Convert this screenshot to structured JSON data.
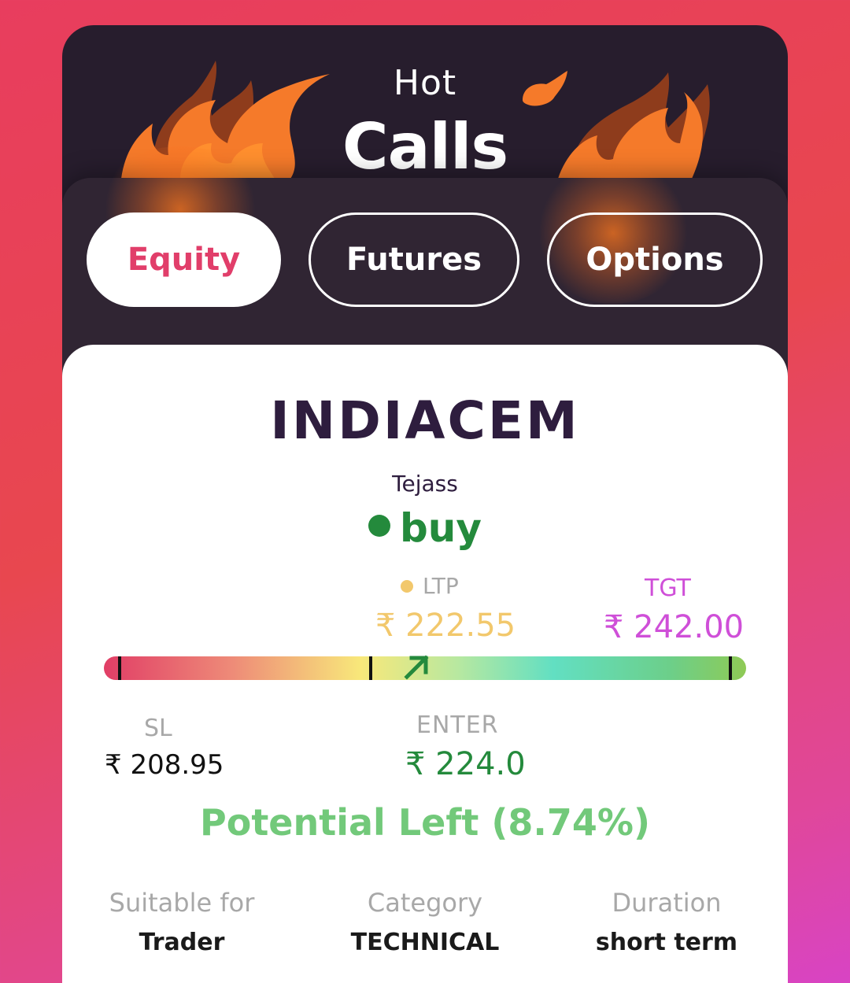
{
  "header": {
    "title_line1": "Hot",
    "title_line2": "Calls"
  },
  "tabs": [
    {
      "label": "Equity",
      "active": true
    },
    {
      "label": "Futures",
      "active": false
    },
    {
      "label": "Options",
      "active": false
    }
  ],
  "call": {
    "symbol": "INDIACEM",
    "analyst": "Tejass",
    "action": "buy",
    "ltp_label": "LTP",
    "ltp_value": "₹ 222.55",
    "tgt_label": "TGT",
    "tgt_value": "₹ 242.00",
    "sl_label": "SL",
    "sl_value": "₹ 208.95",
    "enter_label": "ENTER",
    "enter_value": "₹ 224.0",
    "potential": "Potential Left (8.74%)",
    "range": {
      "sl": 208.95,
      "enter": 224.0,
      "ltp": 222.55,
      "tgt": 242.0
    }
  },
  "meta": [
    {
      "label": "Suitable for",
      "value": "Trader"
    },
    {
      "label": "Category",
      "value": "TECHNICAL"
    },
    {
      "label": "Duration",
      "value": "short term"
    }
  ],
  "colors": {
    "accent_pink": "#e13e6a",
    "buy_green": "#248a3c",
    "ltp_yellow": "#f2c86c",
    "tgt_purple": "#cf4fd8",
    "potential_green": "#72c97a",
    "dark_bg": "#271d2d"
  },
  "icons": {
    "flames": "fire-icon",
    "trend": "arrow-up-right-icon"
  }
}
